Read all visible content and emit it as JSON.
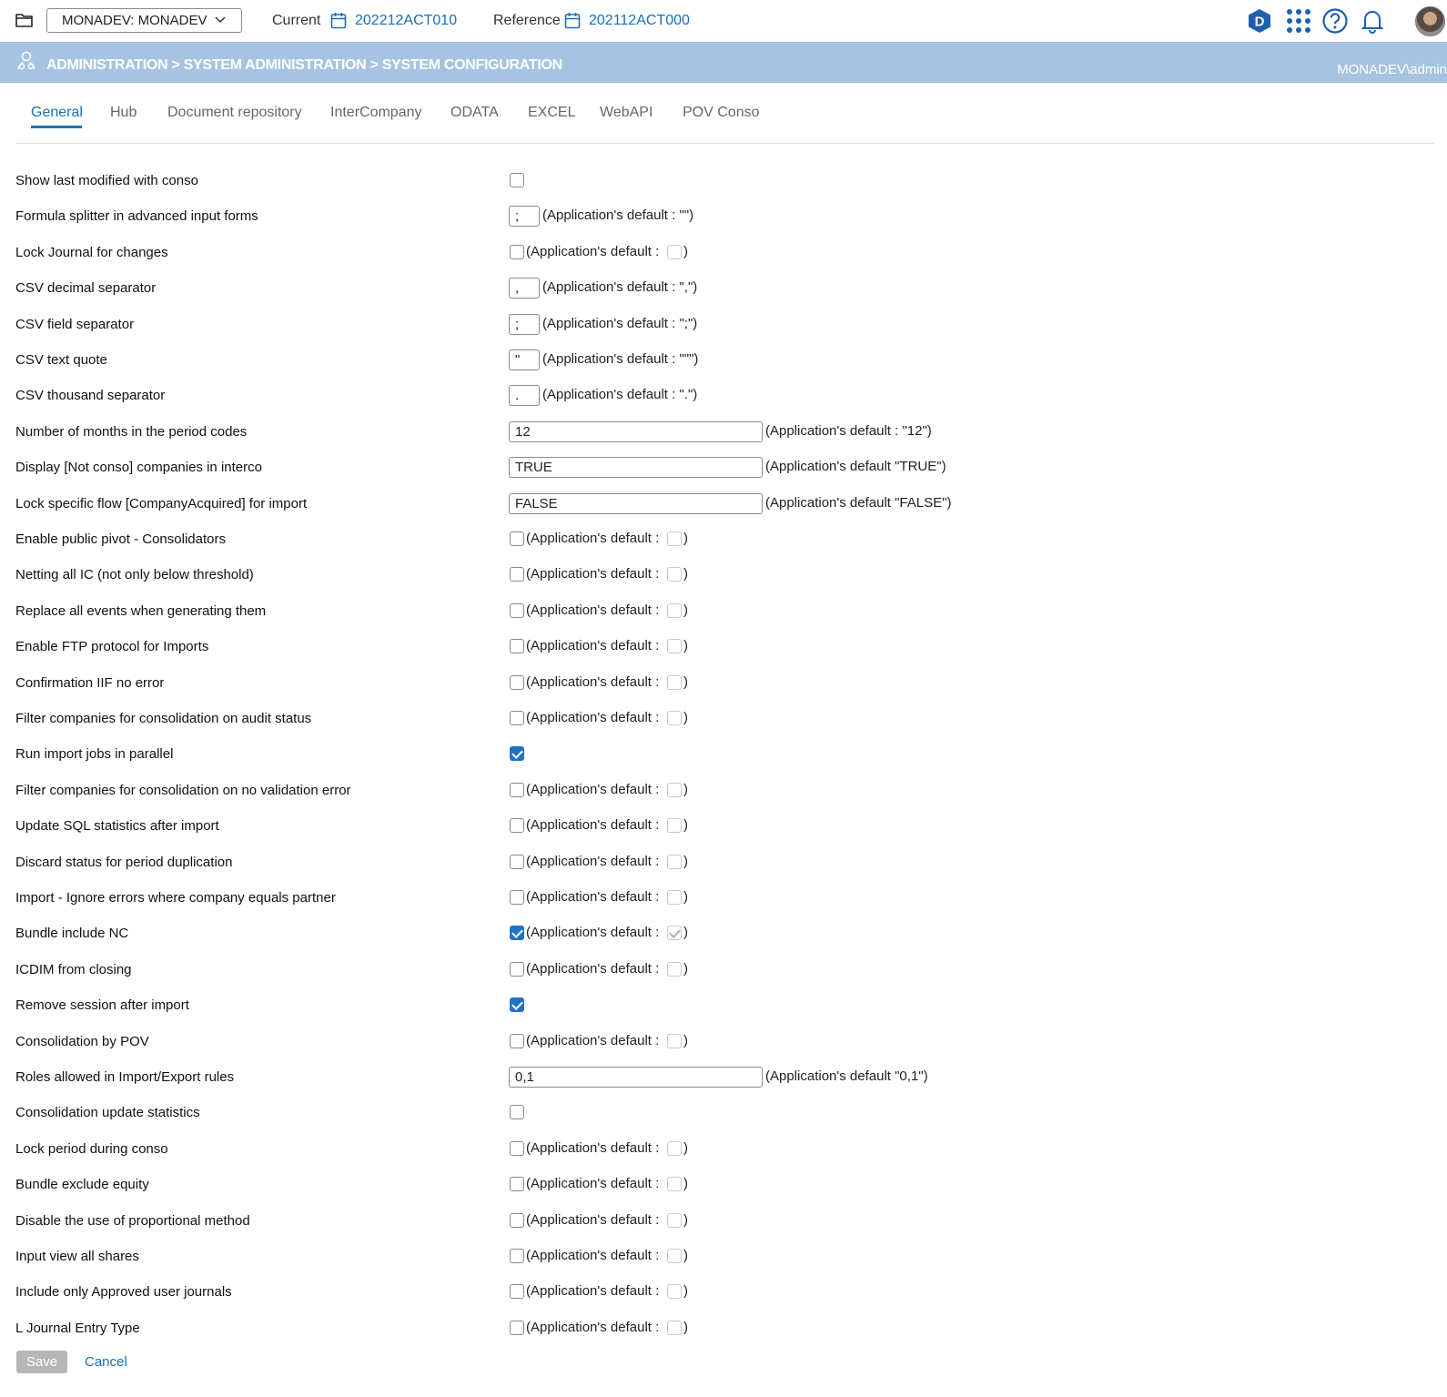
{
  "header": {
    "database_select": "MONADEV: MONADEV",
    "current_label": "Current",
    "current_period": "202212ACT010",
    "reference_label": "Reference",
    "reference_period": "202112ACT000",
    "icons": [
      "folder-icon",
      "chevron-down-icon",
      "calendar-icon",
      "product-logo-icon",
      "apps-grid-icon",
      "help-icon",
      "bell-icon",
      "avatar"
    ]
  },
  "crumbbar": {
    "breadcrumb": "ADMINISTRATION > SYSTEM ADMINISTRATION > SYSTEM CONFIGURATION",
    "user": "MONADEV\\admin",
    "background": "#a6c3e1"
  },
  "tabs": [
    "General",
    "Hub",
    "Document repository",
    "InterCompany",
    "ODATA",
    "EXCEL",
    "WebAPI",
    "POV Conso"
  ],
  "active_tab": "General",
  "settings": [
    {
      "label": "Show last modified with conso",
      "type": "checkbox",
      "checked": false,
      "default": null
    },
    {
      "label": "Formula splitter in advanced input forms",
      "type": "small-input",
      "value": ";",
      "default": "(Application's default : \"\")"
    },
    {
      "label": "Lock Journal for changes",
      "type": "checkbox",
      "checked": false,
      "default": "(Application's default :",
      "default_checked": false
    },
    {
      "label": "CSV decimal separator",
      "type": "small-input",
      "value": ",",
      "default": "(Application's default : \",\")"
    },
    {
      "label": "CSV field separator",
      "type": "small-input",
      "value": ";",
      "default": "(Application's default : \";\")"
    },
    {
      "label": "CSV text quote",
      "type": "small-input",
      "value": "\"",
      "default": "(Application's default : \"\"\")"
    },
    {
      "label": "CSV thousand separator",
      "type": "small-input",
      "value": ".",
      "default": "(Application's default : \".\")"
    },
    {
      "label": "Number of months in the period codes",
      "type": "wide-input",
      "value": "12",
      "default": "(Application's default : \"12\")"
    },
    {
      "label": "Display [Not conso] companies in interco",
      "type": "wide-input",
      "value": "TRUE",
      "default": "(Application's default \"TRUE\")"
    },
    {
      "label": "Lock specific flow [CompanyAcquired] for import",
      "type": "wide-input",
      "value": "FALSE",
      "default": "(Application's default \"FALSE\")"
    },
    {
      "label": "Enable public pivot - Consolidators",
      "type": "checkbox",
      "checked": false,
      "default": "(Application's default :",
      "default_checked": false
    },
    {
      "label": "Netting all IC (not only below threshold)",
      "type": "checkbox",
      "checked": false,
      "default": "(Application's default :",
      "default_checked": false
    },
    {
      "label": "Replace all events when generating them",
      "type": "checkbox",
      "checked": false,
      "default": "(Application's default :",
      "default_checked": false
    },
    {
      "label": "Enable FTP protocol for Imports",
      "type": "checkbox",
      "checked": false,
      "default": "(Application's default :",
      "default_checked": false
    },
    {
      "label": "Confirmation IIF no error",
      "type": "checkbox",
      "checked": false,
      "default": "(Application's default :",
      "default_checked": false
    },
    {
      "label": "Filter companies for consolidation on audit status",
      "type": "checkbox",
      "checked": false,
      "default": "(Application's default :",
      "default_checked": false
    },
    {
      "label": "Run import jobs in parallel",
      "type": "checkbox",
      "checked": true,
      "default": null
    },
    {
      "label": "Filter companies for consolidation on no validation error",
      "type": "checkbox",
      "checked": false,
      "default": "(Application's default :",
      "default_checked": false
    },
    {
      "label": "Update SQL statistics after import",
      "type": "checkbox",
      "checked": false,
      "default": "(Application's default :",
      "default_checked": false
    },
    {
      "label": "Discard status for period duplication",
      "type": "checkbox",
      "checked": false,
      "default": "(Application's default :",
      "default_checked": false
    },
    {
      "label": "Import - Ignore errors where company equals partner",
      "type": "checkbox",
      "checked": false,
      "default": "(Application's default :",
      "default_checked": false
    },
    {
      "label": "Bundle include NC",
      "type": "checkbox",
      "checked": true,
      "default": "(Application's default :",
      "default_checked": true
    },
    {
      "label": "ICDIM from closing",
      "type": "checkbox",
      "checked": false,
      "default": "(Application's default :",
      "default_checked": false
    },
    {
      "label": "Remove session after import",
      "type": "checkbox",
      "checked": true,
      "default": null
    },
    {
      "label": "Consolidation by POV",
      "type": "checkbox",
      "checked": false,
      "default": "(Application's default :",
      "default_checked": false
    },
    {
      "label": "Roles allowed in Import/Export rules",
      "type": "wide-input",
      "value": "0,1",
      "default": "(Application's default \"0,1\")"
    },
    {
      "label": "Consolidation update statistics",
      "type": "checkbox",
      "checked": false,
      "default": null
    },
    {
      "label": "Lock period during conso",
      "type": "checkbox",
      "checked": false,
      "default": "(Application's default :",
      "default_checked": false
    },
    {
      "label": "Bundle exclude equity",
      "type": "checkbox",
      "checked": false,
      "default": "(Application's default :",
      "default_checked": false
    },
    {
      "label": "Disable the use of proportional method",
      "type": "checkbox",
      "checked": false,
      "default": "(Application's default :",
      "default_checked": false
    },
    {
      "label": "Input view all shares",
      "type": "checkbox",
      "checked": false,
      "default": "(Application's default :",
      "default_checked": false
    },
    {
      "label": "Include only Approved user journals",
      "type": "checkbox",
      "checked": false,
      "default": "(Application's default :",
      "default_checked": false
    },
    {
      "label": "L Journal Entry Type",
      "type": "checkbox",
      "checked": false,
      "default": "(Application's default :",
      "default_checked": false
    }
  ],
  "default_suffix": ")",
  "footer": {
    "save": "Save",
    "cancel": "Cancel"
  },
  "colors": {
    "accent": "#1a6fb5",
    "checkbox_checked": "#1e73c8",
    "save_disabled": "#b6b6b6"
  }
}
